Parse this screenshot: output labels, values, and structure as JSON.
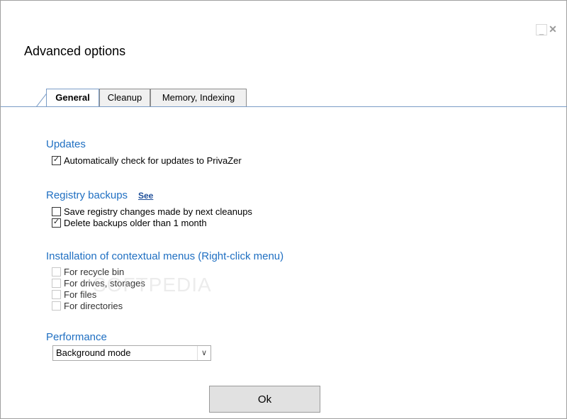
{
  "window": {
    "title": "Advanced options",
    "minimize_label": "_",
    "close_label": "✕"
  },
  "tabs": [
    {
      "label": "General",
      "active": true
    },
    {
      "label": "Cleanup",
      "active": false
    },
    {
      "label": "Memory, Indexing",
      "active": false
    }
  ],
  "updates": {
    "heading": "Updates",
    "auto_check": {
      "label": "Automatically check for updates to PrivaZer",
      "checked": true
    }
  },
  "registry": {
    "heading": "Registry backups",
    "see_link": "See",
    "save_changes": {
      "label": "Save registry changes made by next cleanups",
      "checked": false
    },
    "delete_old": {
      "label": "Delete backups older than 1 month",
      "checked": true
    }
  },
  "context_menus": {
    "heading": "Installation of contextual menus (Right-click menu)",
    "recycle_bin": {
      "label": "For recycle bin",
      "checked": false
    },
    "drives": {
      "label": "For drives, storages",
      "checked": false
    },
    "files": {
      "label": "For files",
      "checked": false
    },
    "directories": {
      "label": "For directories",
      "checked": false
    }
  },
  "performance": {
    "heading": "Performance",
    "selected": "Background mode"
  },
  "ok_label": "Ok",
  "watermark": "SOFTPEDIA"
}
